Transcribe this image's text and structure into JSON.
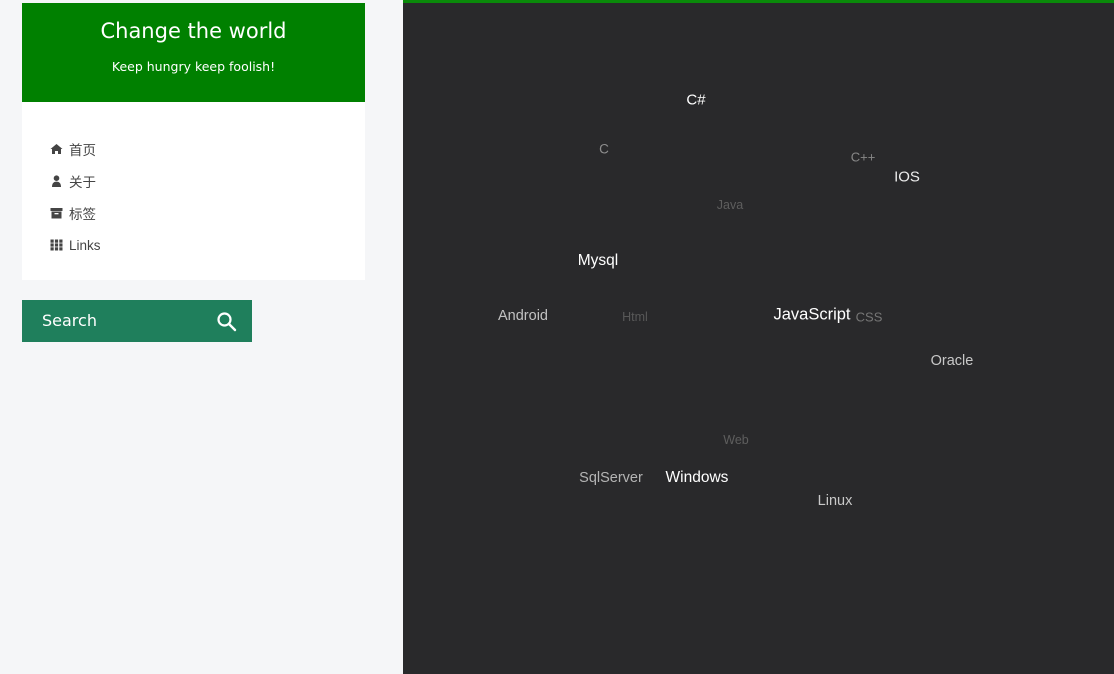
{
  "brand": {
    "title": "Change the world",
    "subtitle": "Keep hungry keep foolish!",
    "color": "#008000"
  },
  "menu": {
    "items": [
      {
        "label": "首页",
        "icon": "home-icon"
      },
      {
        "label": "关于",
        "icon": "user-icon"
      },
      {
        "label": "标签",
        "icon": "archive-icon"
      },
      {
        "label": "Links",
        "icon": "grid-icon"
      }
    ]
  },
  "search": {
    "label": "Search",
    "icon": "search-icon",
    "color": "#1f7f5c"
  },
  "tag_cloud": {
    "background": "#29292b",
    "tags": [
      "C#",
      "C",
      "C++",
      "IOS",
      "Java",
      "Mysql",
      "Android",
      "Html",
      "JavaScript",
      "CSS",
      "Oracle",
      "Web",
      "SqlServer",
      "Windows",
      "Linux"
    ]
  }
}
